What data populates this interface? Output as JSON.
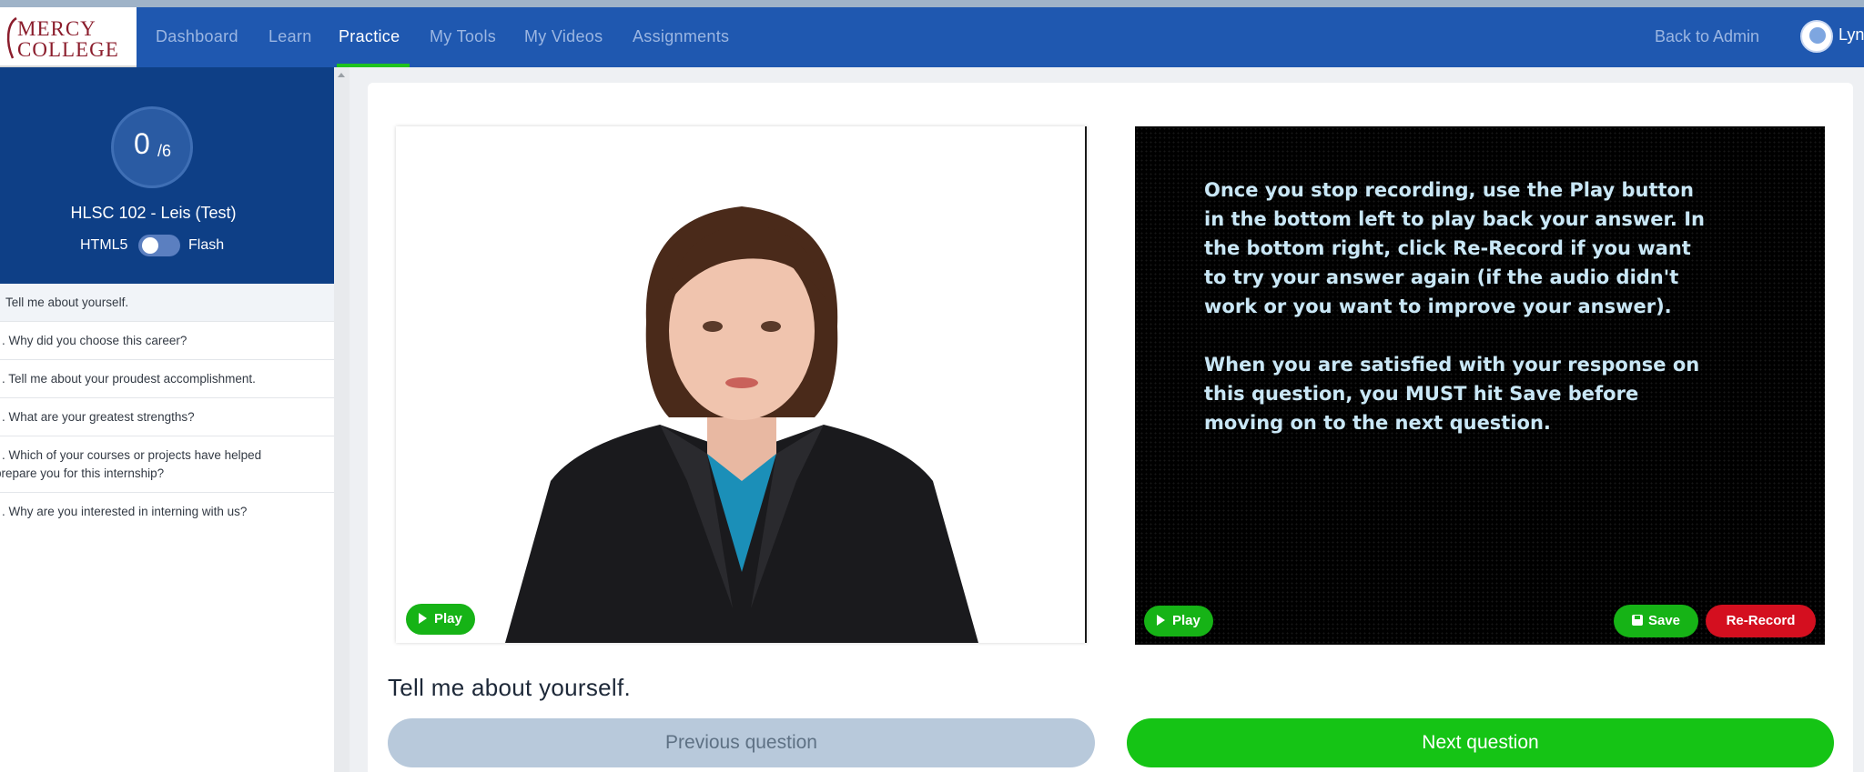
{
  "brand": {
    "logo_line1": "MERCY",
    "logo_line2": "COLLEGE",
    "maroon": "#8b1d2c"
  },
  "navbar": {
    "color": "#1f58b0",
    "items": [
      {
        "label": "Dashboard",
        "active": false
      },
      {
        "label": "Learn",
        "active": false
      },
      {
        "label": "Practice",
        "active": true
      },
      {
        "label": "My Tools",
        "active": false
      },
      {
        "label": "My Videos",
        "active": false
      },
      {
        "label": "Assignments",
        "active": false
      }
    ],
    "back_admin": "Back to Admin",
    "user_name": "Lyn"
  },
  "sidebar": {
    "score_done": "0",
    "score_total": "/6",
    "course_title": "HLSC 102 - Leis (Test)",
    "toggle_left": "HTML5",
    "toggle_right": "Flash",
    "questions": [
      "Tell me about yourself.",
      ". Why did you choose this career?",
      ". Tell me about your proudest accomplishment.",
      ". What are your greatest strengths?",
      ". Which of your courses or projects have helped prepare you for this internship?",
      ". Why are you interested in interning with us?"
    ]
  },
  "main": {
    "left_play": "Play",
    "right_play": "Play",
    "save_label": "Save",
    "rerecord_label": "Re-Record",
    "instructions_p1": "Once you stop recording, use the Play button in the bottom left to play back your answer. In the bottom right, click Re-Record if you want to try your answer again (if the audio didn't work or you want to improve your answer).",
    "instructions_p2": "When you are satisfied with your response on this question, you MUST hit Save before moving on to the next question.",
    "question_title": "Tell me about yourself.",
    "prev_label": "Previous question",
    "next_label": "Next question",
    "colors": {
      "green": "#16b316",
      "red": "#d40f1f",
      "prev_bg": "#b8c9db"
    }
  }
}
